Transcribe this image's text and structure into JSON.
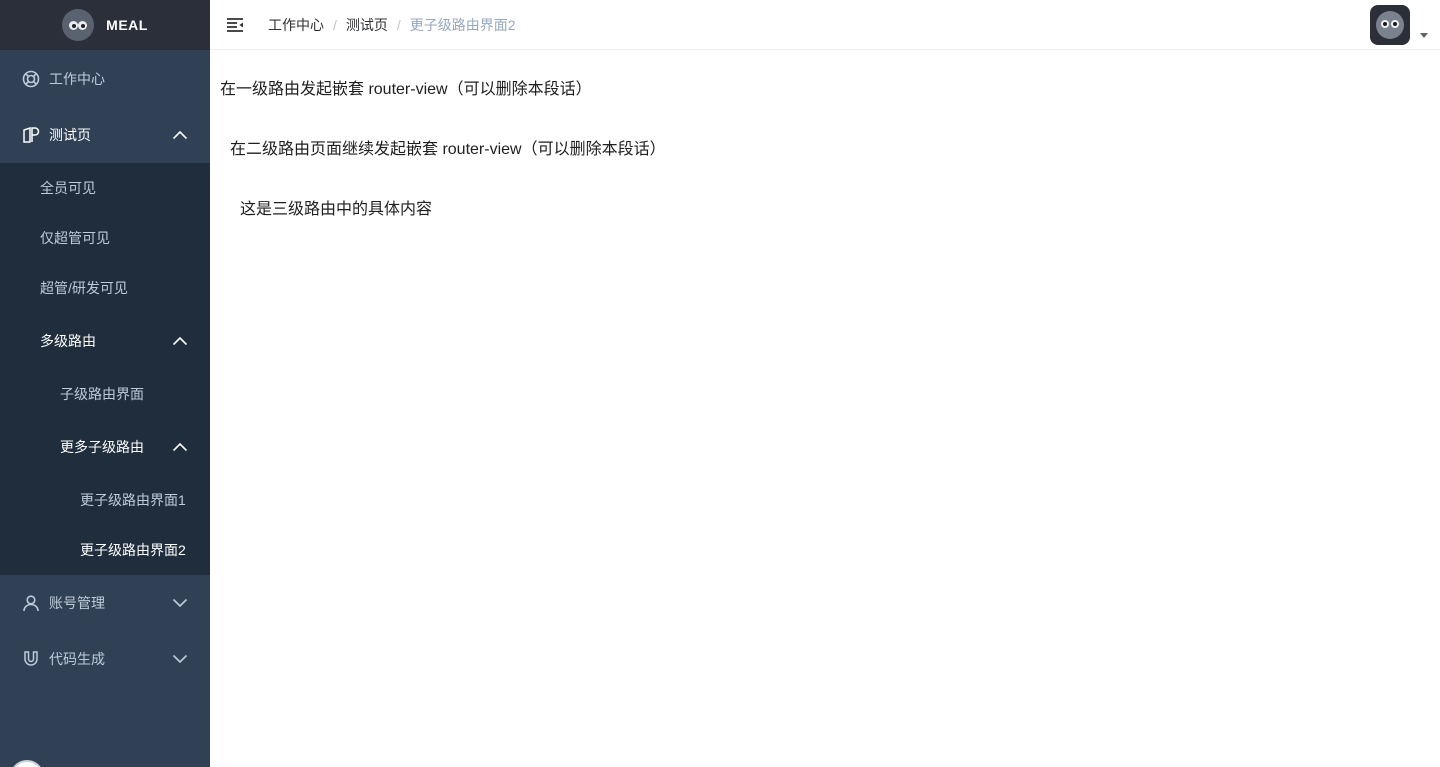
{
  "logo": {
    "title": "MEAL"
  },
  "sidebar": {
    "dashboard": "工作中心",
    "test_page": "测试页",
    "test_children": {
      "all_visible": "全员可见",
      "super_only": "仅超管可见",
      "super_dev": "超管/研发可见",
      "multi_route": "多级路由",
      "child_route_page": "子级路由界面",
      "more_child_routes": "更多子级路由",
      "sub_page_1": "更子级路由界面1",
      "sub_page_2": "更子级路由界面2"
    },
    "account_mgmt": "账号管理",
    "code_gen": "代码生成"
  },
  "breadcrumb": {
    "items": [
      "工作中心",
      "测试页",
      "更子级路由界面2"
    ],
    "separator": "/"
  },
  "content": {
    "level1_text": "在一级路由发起嵌套 router-view（可以删除本段话）",
    "level2_text": "在二级路由页面继续发起嵌套 router-view（可以删除本段话）",
    "level3_text": "这是三级路由中的具体内容"
  },
  "colors": {
    "sidebar_bg": "#304156",
    "submenu_bg": "#1f2d3d",
    "sidebar_text": "#bfcbd9",
    "breadcrumb_last": "#97a8be"
  }
}
